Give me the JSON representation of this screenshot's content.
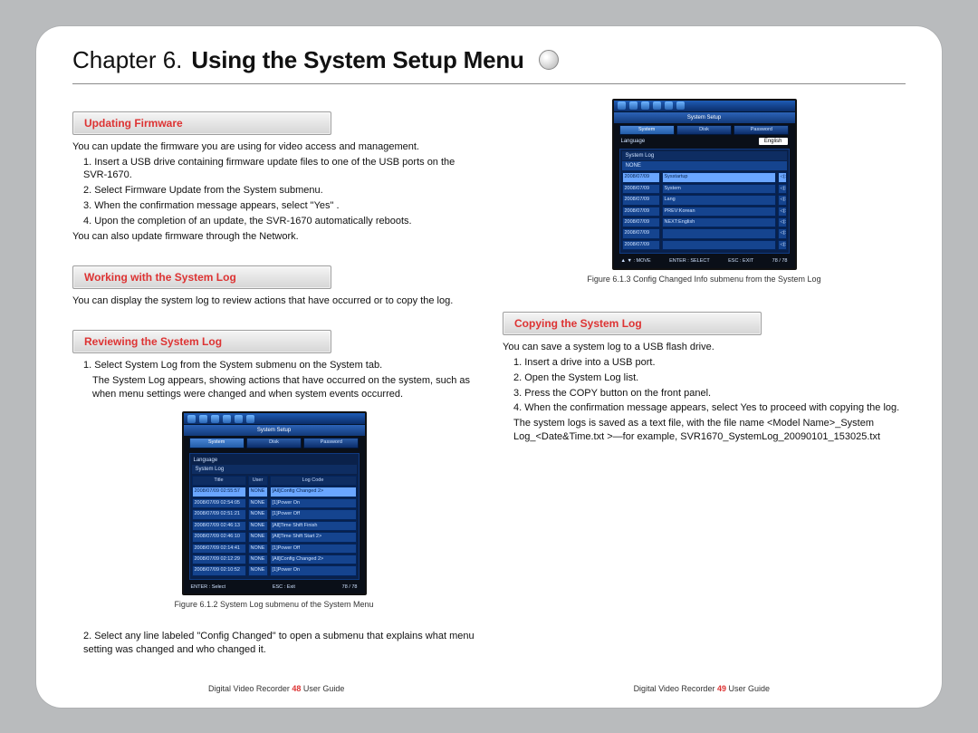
{
  "chapter": {
    "number": "Chapter 6.",
    "title": "Using the System Setup Menu"
  },
  "sections": {
    "updating_firmware": {
      "heading": "Updating Firmware",
      "intro": "You can update the firmware you are using for video access and management.",
      "steps": [
        "1. Insert a USB drive containing firmware update files to one of the USB ports on the SVR-1670.",
        "2. Select Firmware Update from the System submenu.",
        "3. When the confirmation message appears, select \"Yes\" .",
        "4. Upon the completion of an update, the SVR-1670 automatically reboots."
      ],
      "outro": "You can also update firmware through the Network."
    },
    "working_syslog": {
      "heading": "Working with the System Log",
      "intro": "You can display the system log to review actions that have occurred or to copy the log."
    },
    "reviewing_syslog": {
      "heading": "Reviewing the System Log",
      "step1_a": "1. Select System Log from the System submenu on the System tab.",
      "step1_b": "The System Log appears, showing actions that have occurred on the system, such as when menu settings were changed and when system events occurred.",
      "step2": "2. Select any line labeled \"Config Changed\" to open a submenu that explains what menu setting was changed and who changed it."
    },
    "copying_syslog": {
      "heading": "Copying the System Log",
      "intro": "You can save a system log to a USB flash drive.",
      "steps": [
        "1. Insert a drive into a USB port.",
        "2. Open the System Log list.",
        "3. Press the COPY button on the front panel.",
        "4. When the confirmation message appears, select Yes to proceed with copying the log."
      ],
      "outro": "The system logs is saved as a text file, with the file name <Model Name>_System Log_<Date&Time.txt >—for example, SVR1670_SystemLog_20090101_153025.txt"
    }
  },
  "figures": {
    "fig612": "Figure 6.1.2 System Log submenu of the System Menu",
    "fig613": "Figure 6.1.3 Config Changed Info submenu from the System Log"
  },
  "footer": {
    "left_pre": "Digital Video Recorder ",
    "left_num": "48",
    "left_post": " User Guide",
    "right_pre": "Digital Video Recorder ",
    "right_num": "49",
    "right_post": " User Guide"
  },
  "chart_data": {
    "type": "table",
    "title": "System Log",
    "columns": [
      "Title",
      "User",
      "Log Code"
    ],
    "rows": [
      [
        "2008/07/09 02:55:57",
        "NONE",
        "[All]Config Changed 2>"
      ],
      [
        "2008/07/09 02:54:05",
        "NONE",
        "[1]Power On"
      ],
      [
        "2008/07/09 02:51:21",
        "NONE",
        "[1]Power Off"
      ],
      [
        "2008/07/09 02:46:13",
        "NONE",
        "[All]Time Shift Finish"
      ],
      [
        "2008/07/09 02:46:10",
        "NONE",
        "[All]Time Shift Start 2>"
      ],
      [
        "2008/07/09 02:14:41",
        "NONE",
        "[1]Power Off"
      ],
      [
        "2008/07/09 02:12:29",
        "NONE",
        "[All]Config Changed 2>"
      ],
      [
        "2008/07/09 02:10:52",
        "NONE",
        "[1]Power On"
      ]
    ],
    "footer_hint_left": "ENTER : Select",
    "footer_hint_right": "ESC : Exit",
    "page_indicator": "78 / 78"
  },
  "fig613_data": {
    "title": "System Setup",
    "tabs": [
      "System",
      "Disk",
      "Password"
    ],
    "field_language": "Language",
    "field_value": "English",
    "group": "System Log",
    "option_none": "NONE",
    "rows": [
      [
        "2008/07/09",
        "Sysstartup"
      ],
      [
        "2008/07/09",
        "System"
      ],
      [
        "2008/07/09",
        "Lang"
      ],
      [
        "2008/07/09",
        "PREV:Korean"
      ],
      [
        "2008/07/09",
        "NEXT:English"
      ],
      [
        "2008/07/09",
        ""
      ],
      [
        "2008/07/09",
        ""
      ]
    ],
    "footer_move": "▲ ▼ : MOVE",
    "footer_select": "ENTER : SELECT",
    "footer_exit": "ESC : EXIT",
    "page_indicator": "78 / 78"
  }
}
